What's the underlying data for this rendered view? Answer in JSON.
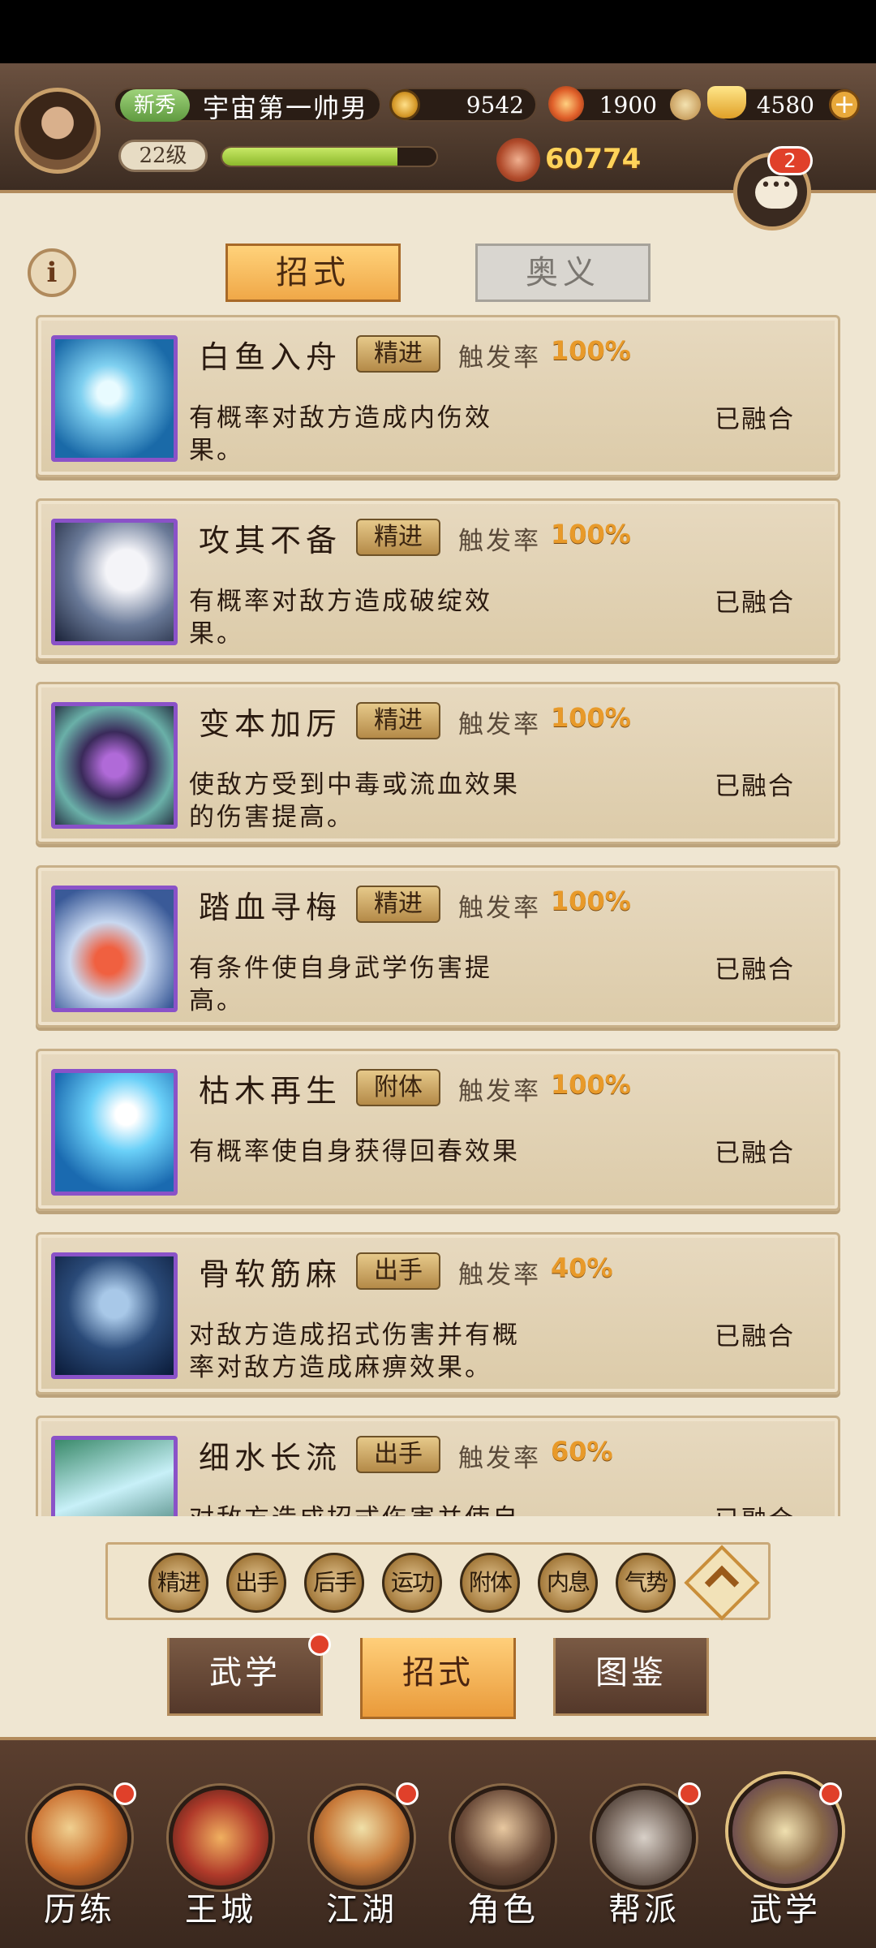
{
  "player": {
    "badge": "新秀",
    "name": "宇宙第一帅男",
    "level": "22级",
    "xp_fraction": 0.82,
    "power": "60774"
  },
  "currencies": {
    "coins": "9542",
    "ember": "1900",
    "gold_ingot": "4580"
  },
  "chat": {
    "unread": "2"
  },
  "info_icon": "i",
  "tabs": [
    {
      "label": "招式",
      "active": true
    },
    {
      "label": "奥义",
      "active": false
    }
  ],
  "trigger_label": "触发率",
  "skills": [
    {
      "name": "白鱼入舟",
      "tag": "精进",
      "rate": "100%",
      "desc": "有概率对敌方造成内伤效果。",
      "status": "已融合",
      "icon": "white-fish-icon"
    },
    {
      "name": "攻其不备",
      "tag": "精进",
      "rate": "100%",
      "desc": "有概率对敌方造成破绽效果。",
      "status": "已融合",
      "icon": "sword-strike-icon"
    },
    {
      "name": "变本加厉",
      "tag": "精进",
      "rate": "100%",
      "desc": "使敌方受到中毒或流血效果的伤害提高。",
      "status": "已融合",
      "icon": "purple-vortex-icon"
    },
    {
      "name": "踏血寻梅",
      "tag": "精进",
      "rate": "100%",
      "desc": "有条件使自身武学伤害提高。",
      "status": "已融合",
      "icon": "red-plum-icon"
    },
    {
      "name": "枯木再生",
      "tag": "附体",
      "rate": "100%",
      "desc": "有概率使自身获得回春效果",
      "status": "已融合",
      "icon": "withered-tree-icon"
    },
    {
      "name": "骨软筋麻",
      "tag": "出手",
      "rate": "40%",
      "desc": "对敌方造成招式伤害并有概率对敌方造成麻痹效果。",
      "status": "已融合",
      "icon": "flame-hands-icon"
    },
    {
      "name": "细水长流",
      "tag": "出手",
      "rate": "60%",
      "desc": "对敌方造成招式伤害并使自身获得回",
      "status": "已融合",
      "icon": "river-icon"
    }
  ],
  "filters": [
    "精进",
    "出手",
    "后手",
    "运功",
    "附体",
    "内息",
    "气势"
  ],
  "subtabs": [
    {
      "label": "武学",
      "active": false
    },
    {
      "label": "招式",
      "active": true
    },
    {
      "label": "图鉴",
      "active": false
    }
  ],
  "nav": [
    {
      "label": "历练",
      "icon": "training-scroll-icon"
    },
    {
      "label": "王城",
      "icon": "palace-icon"
    },
    {
      "label": "江湖",
      "icon": "jianghu-icon"
    },
    {
      "label": "角色",
      "icon": "character-icon"
    },
    {
      "label": "帮派",
      "icon": "sect-icon"
    },
    {
      "label": "武学",
      "icon": "martial-scroll-icon"
    }
  ],
  "colors": {
    "accent_orange": "#f0a848",
    "skill_border": "#8a52c8",
    "rate_orange": "#e89a2a",
    "badge_red": "#e0402a"
  }
}
